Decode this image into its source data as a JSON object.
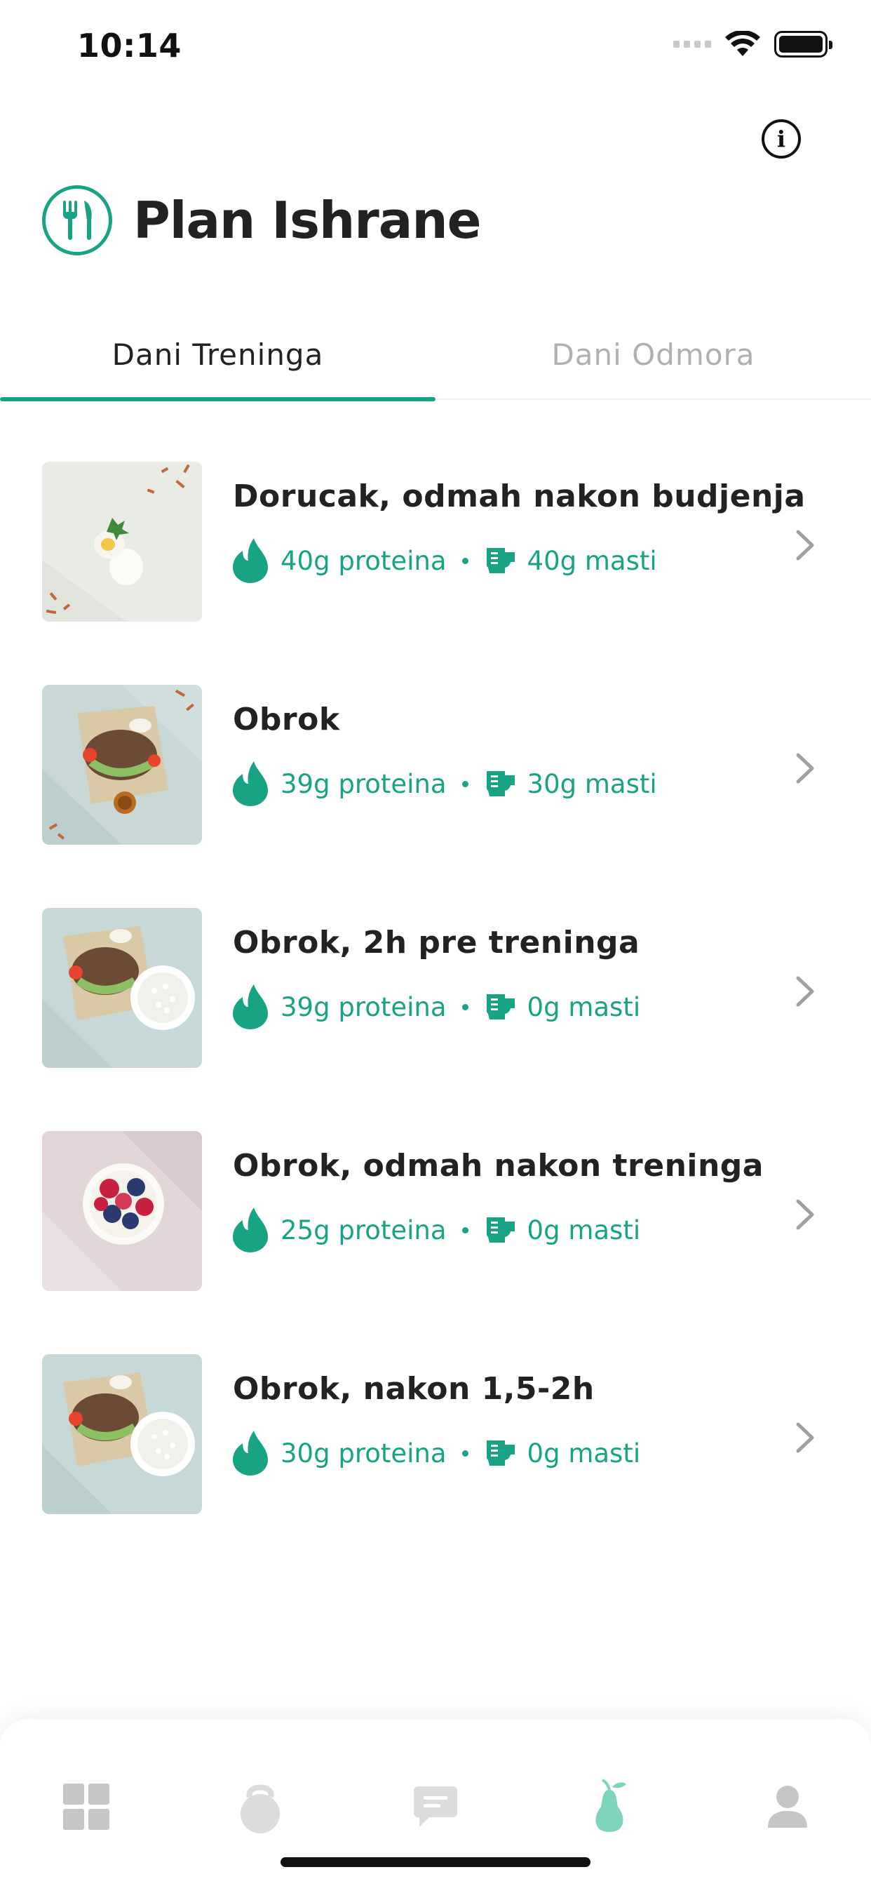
{
  "status_bar": {
    "time": "10:14"
  },
  "header": {
    "title": "Plan Ishrane"
  },
  "tabs": [
    {
      "label": "Dani Treninga",
      "active": true
    },
    {
      "label": "Dani Odmora",
      "active": false
    }
  ],
  "meals": [
    {
      "title": "Dorucak, odmah nakon budjenja",
      "protein": "40g proteina",
      "fat": "40g masti",
      "thumb": "eggs"
    },
    {
      "title": "Obrok",
      "protein": "39g proteina",
      "fat": "30g masti",
      "thumb": "steak-sauce"
    },
    {
      "title": "Obrok, 2h pre treninga",
      "protein": "39g proteina",
      "fat": "0g masti",
      "thumb": "steak-rice"
    },
    {
      "title": "Obrok, odmah nakon treninga",
      "protein": "25g proteina",
      "fat": "0g masti",
      "thumb": "berries"
    },
    {
      "title": "Obrok, nakon 1,5-2h",
      "protein": "30g proteina",
      "fat": "0g masti",
      "thumb": "steak-rice"
    }
  ],
  "bottom_nav": [
    {
      "icon": "dashboard-icon",
      "active": false
    },
    {
      "icon": "kettlebell-icon",
      "active": false
    },
    {
      "icon": "chat-icon",
      "active": false
    },
    {
      "icon": "pear-icon",
      "active": true
    },
    {
      "icon": "profile-icon",
      "active": false
    }
  ],
  "colors": {
    "accent": "#17a384",
    "inactive": "#c6c6c6",
    "text": "#222222"
  }
}
